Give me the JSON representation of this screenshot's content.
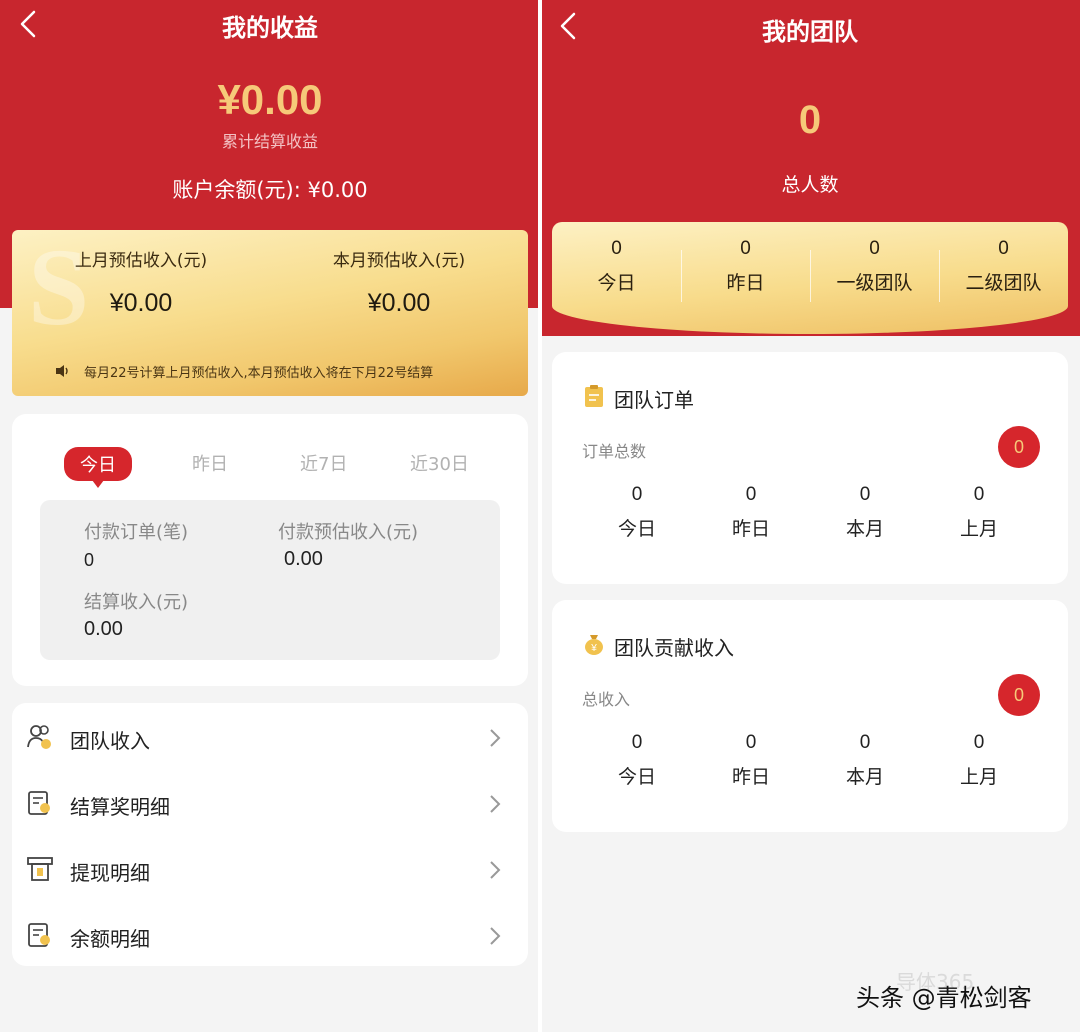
{
  "earnings": {
    "title": "我的收益",
    "total_amount": "¥0.00",
    "total_label": "累计结算收益",
    "balance_line": "账户余额(元): ¥0.00",
    "last_month": {
      "label": "上月预估收入(元)",
      "value": "¥0.00"
    },
    "this_month": {
      "label": "本月预估收入(元)",
      "value": "¥0.00"
    },
    "notice": "每月22号计算上月预估收入,本月预估收入将在下月22号结算",
    "tabs": [
      "今日",
      "昨日",
      "近7日",
      "近30日"
    ],
    "active_tab": "今日",
    "stats": {
      "paid_orders": {
        "label": "付款订单(笔)",
        "value": "0"
      },
      "paid_est_income": {
        "label": "付款预估收入(元)",
        "value": "0.00"
      },
      "settled_income": {
        "label": "结算收入(元)",
        "value": "0.00"
      }
    },
    "menu": [
      {
        "label": "团队收入",
        "icon": "team-users-icon"
      },
      {
        "label": "结算奖明细",
        "icon": "settlement-doc-icon"
      },
      {
        "label": "提现明细",
        "icon": "withdraw-icon"
      },
      {
        "label": "余额明细",
        "icon": "balance-doc-icon"
      }
    ]
  },
  "team": {
    "title": "我的团队",
    "count": "0",
    "count_label": "总人数",
    "strip": [
      {
        "value": "0",
        "label": "今日"
      },
      {
        "value": "0",
        "label": "昨日"
      },
      {
        "value": "0",
        "label": "一级团队"
      },
      {
        "value": "0",
        "label": "二级团队"
      }
    ],
    "orders": {
      "title": "团队订单",
      "subtitle": "订单总数",
      "badge": "0",
      "cols": [
        {
          "value": "0",
          "label": "今日"
        },
        {
          "value": "0",
          "label": "昨日"
        },
        {
          "value": "0",
          "label": "本月"
        },
        {
          "value": "0",
          "label": "上月"
        }
      ]
    },
    "contribution": {
      "title": "团队贡献收入",
      "subtitle": "总收入",
      "badge": "0",
      "cols": [
        {
          "value": "0",
          "label": "今日"
        },
        {
          "value": "0",
          "label": "昨日"
        },
        {
          "value": "0",
          "label": "本月"
        },
        {
          "value": "0",
          "label": "上月"
        }
      ]
    }
  },
  "watermark": {
    "faint": "导体365",
    "main": "头条 @青松剑客"
  },
  "colors": {
    "brand_red": "#c8262e",
    "gold": "#f6c979",
    "badge_red": "#d6262c"
  }
}
